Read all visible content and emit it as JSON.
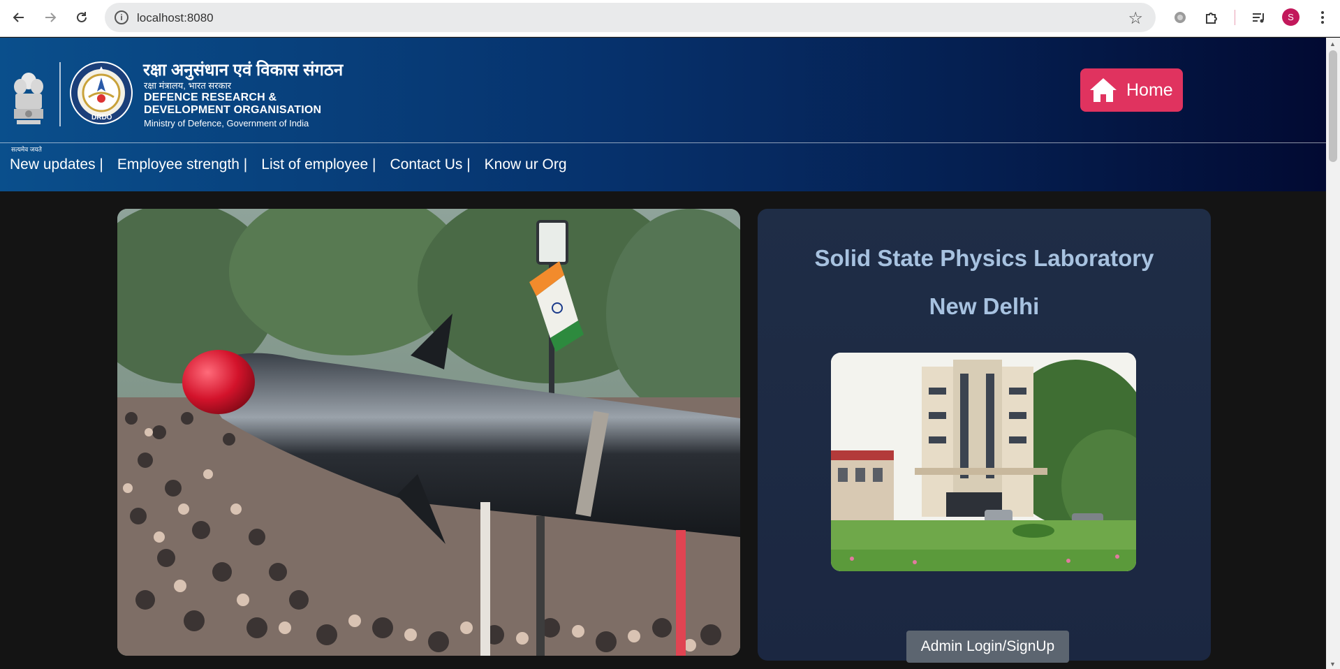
{
  "browser": {
    "url": "localhost:8080",
    "profile_initial": "S",
    "icons": [
      "back-icon",
      "forward-icon",
      "reload-icon",
      "info-icon",
      "star-icon",
      "extension-icon",
      "puzzle-icon",
      "media-icon",
      "kebab-menu-icon"
    ]
  },
  "header": {
    "emblem_motto": "सत्यमेव जयते",
    "org_name_hindi": "रक्षा अनुसंधान एवं विकास संगठन",
    "ministry_hindi": "रक्षा मंत्रालय, भारत सरकार",
    "org_name_en_line1": "DEFENCE RESEARCH &",
    "org_name_en_line2": "DEVELOPMENT ORGANISATION",
    "ministry_en": "Ministry of Defence, Government of India",
    "seal_text": "DRDO",
    "home_label": "Home",
    "home_color": "#e0335f"
  },
  "nav": {
    "items": [
      "New updates |",
      "Employee strength |",
      "List of employee |",
      "Contact Us |",
      "Know ur Org"
    ]
  },
  "card": {
    "lab_name": "Solid State Physics Laboratory",
    "lab_city": "New Delhi",
    "admin_button": "Admin Login/SignUp",
    "title_color": "#a7c2e0"
  }
}
